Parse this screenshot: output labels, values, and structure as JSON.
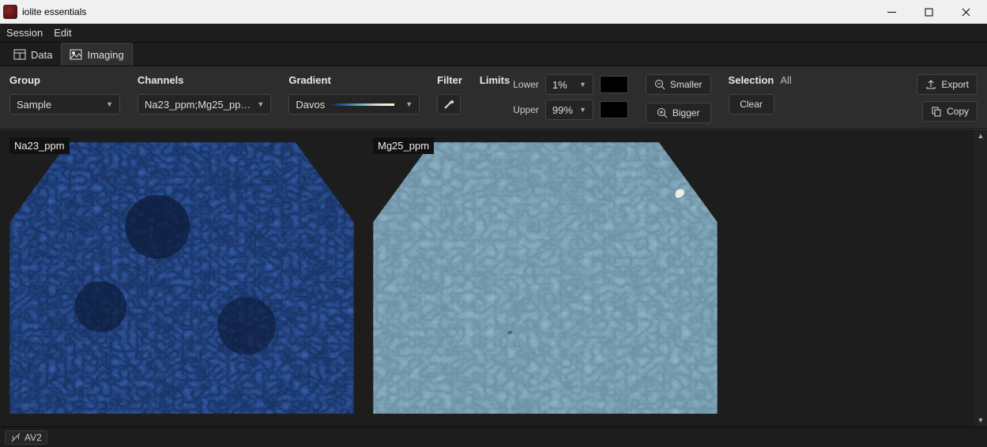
{
  "window": {
    "title": "iolite essentials"
  },
  "menus": {
    "session": "Session",
    "edit": "Edit"
  },
  "tabs": {
    "data": "Data",
    "imaging": "Imaging"
  },
  "controls": {
    "group": {
      "label": "Group",
      "value": "Sample"
    },
    "channels": {
      "label": "Channels",
      "value": "Na23_ppm;Mg25_pp…"
    },
    "gradient": {
      "label": "Gradient",
      "value": "Davos"
    },
    "filter": {
      "label": "Filter"
    },
    "limits": {
      "label": "Limits",
      "lower_label": "Lower",
      "upper_label": "Upper",
      "lower_value": "1%",
      "upper_value": "99%"
    },
    "zoom": {
      "smaller": "Smaller",
      "bigger": "Bigger"
    },
    "selection": {
      "label": "Selection",
      "value": "All",
      "clear": "Clear"
    },
    "export": "Export",
    "copy": "Copy"
  },
  "images": {
    "left_label": "Na23_ppm",
    "right_label": "Mg25_ppm"
  },
  "status": {
    "item": "AV2"
  }
}
